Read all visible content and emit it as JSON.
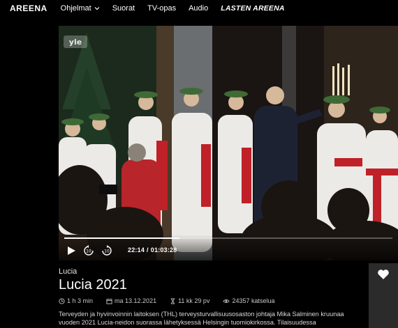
{
  "nav": {
    "brand": "AREENA",
    "items": [
      {
        "label": "Ohjelmat"
      },
      {
        "label": "Suorat"
      },
      {
        "label": "TV-opas"
      },
      {
        "label": "Audio"
      },
      {
        "label": "LASTEN AREENA"
      }
    ]
  },
  "player": {
    "logo": "yle",
    "current_time": "22:14",
    "separator": "/",
    "duration": "01:03:28",
    "progress_fraction": 0.35,
    "controls": [
      "play-icon",
      "rewind-10-icon",
      "forward-10-icon"
    ]
  },
  "program": {
    "category": "Lucia",
    "title": "Lucia 2021",
    "duration": "1 h 3 min",
    "date": "ma 13.12.2021",
    "availability": "11 kk 29 pv",
    "views": "24357 katselua",
    "description": "Terveyden ja hyvinvoinnin laitoksen (THL) terveysturvallisuusosaston johtaja Mika Salminen kruunaa vuoden 2021 Lucia-neidon suorassa lähetyksessä Helsingin tuomiokirkossa. Tilaisuudessa"
  },
  "colors": {
    "background": "#000000",
    "panel": "#2b2b2b",
    "text": "#ffffff"
  }
}
